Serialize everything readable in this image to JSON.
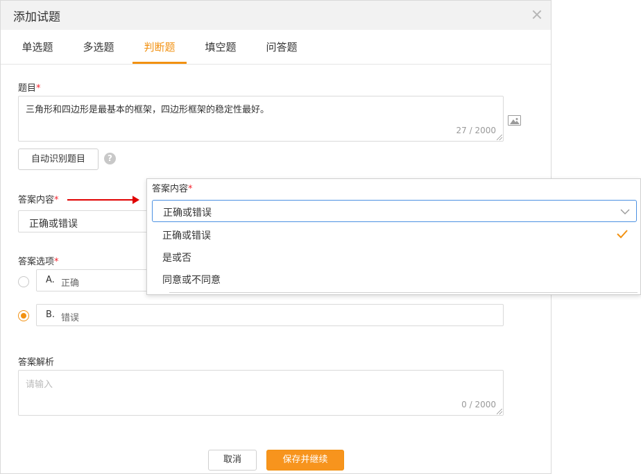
{
  "dialog": {
    "title": "添加试题"
  },
  "tabs": [
    {
      "label": "单选题",
      "active": false
    },
    {
      "label": "多选题",
      "active": false
    },
    {
      "label": "判断题",
      "active": true
    },
    {
      "label": "填空题",
      "active": false
    },
    {
      "label": "问答题",
      "active": false
    }
  ],
  "question": {
    "label": "题目",
    "required_mark": "*",
    "value": "三角形和四边形是最基本的框架，四边形框架的稳定性最好。",
    "counter": "27 / 2000",
    "auto_recognize_label": "自动识别题目",
    "help_glyph": "?"
  },
  "answer_content": {
    "label": "答案内容",
    "required_mark": "*",
    "selected": "正确或错误"
  },
  "answer_options": {
    "label": "答案选项",
    "required_mark": "*",
    "options": [
      {
        "letter": "A.",
        "text": "正确",
        "checked": false
      },
      {
        "letter": "B.",
        "text": "错误",
        "checked": true
      }
    ]
  },
  "analysis": {
    "label": "答案解析",
    "placeholder": "请输入",
    "counter": "0 / 2000"
  },
  "footer": {
    "cancel_label": "取消",
    "save_label": "保存并继续"
  },
  "dropdown_popup": {
    "label": "答案内容",
    "required_mark": "*",
    "selected": "正确或错误",
    "items": [
      {
        "label": "正确或错误",
        "selected": true
      },
      {
        "label": "是或否",
        "selected": false
      },
      {
        "label": "同意或不同意",
        "selected": false
      }
    ]
  },
  "colors": {
    "accent": "#f29111",
    "primary_button": "#f7941d",
    "focus_border": "#4a90e2",
    "arrow": "#e00000"
  },
  "icons": [
    "close-icon",
    "image-icon",
    "help-icon",
    "chevron-down-icon",
    "check-icon",
    "arrow-annotation"
  ]
}
